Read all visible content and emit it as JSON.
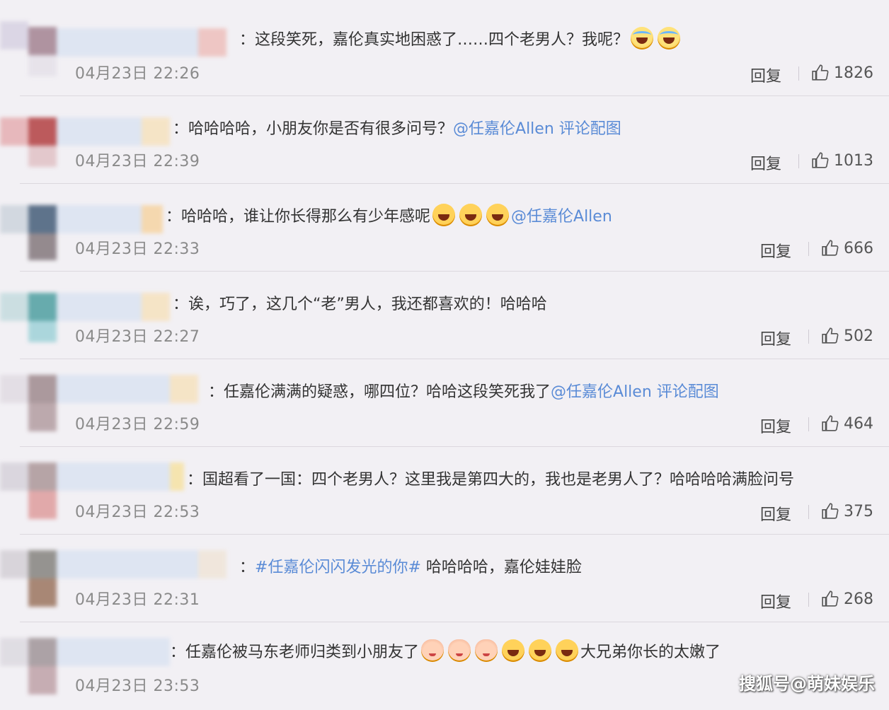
{
  "reply_label": "回复",
  "watermark": "搜狐号@萌妹娱乐",
  "comments": [
    {
      "text": "：这段笑死，嘉伦真实地困惑了……四个老男人？我呢？",
      "link": "",
      "tail": "",
      "emojis_after": [
        "cry",
        "cry"
      ],
      "time": "04月23日 22:26",
      "likes": "1826"
    },
    {
      "text": "：哈哈哈哈，小朋友你是否有很多问号？",
      "link": "@任嘉伦Allen 评论配图",
      "tail": "",
      "emojis_after": [],
      "time": "04月23日 22:39",
      "likes": "1013"
    },
    {
      "text": "：哈哈哈，谁让你长得那么有少年感呢",
      "link": "@任嘉伦Allen",
      "tail": "",
      "emojis_before_link": [
        "laugh",
        "laugh",
        "laugh"
      ],
      "time": "04月23日 22:33",
      "likes": "666"
    },
    {
      "text": "：诶，巧了，这几个“老”男人，我还都喜欢的！哈哈哈",
      "link": "",
      "tail": "",
      "time": "04月23日 22:27",
      "likes": "502"
    },
    {
      "text": "：任嘉伦满满的疑惑，哪四位？哈哈这段笑死我了",
      "link": "@任嘉伦Allen 评论配图",
      "tail": "",
      "time": "04月23日 22:59",
      "likes": "464"
    },
    {
      "text": "：国超看了一国：四个老男人？这里我是第四大的，我也是老男人了？哈哈哈哈满脸问号",
      "link": "",
      "tail": "",
      "time": "04月23日 22:53",
      "likes": "375"
    },
    {
      "text": "：",
      "link": "#任嘉伦闪闪发光的你#",
      "tail": " 哈哈哈哈，嘉伦娃娃脸",
      "time": "04月23日 22:31",
      "likes": "268"
    },
    {
      "text": "：任嘉伦被马东老师归类到小朋友了",
      "link": "",
      "tail": "大兄弟你长的太嫩了",
      "time": "04月23日 23:53",
      "likes": ""
    }
  ]
}
